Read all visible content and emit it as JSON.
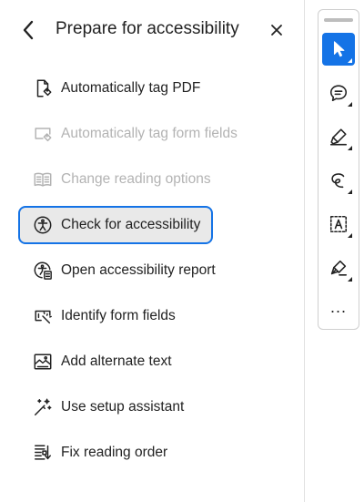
{
  "panel": {
    "title": "Prepare for accessibility",
    "back_icon": "chevron-left-icon",
    "close_icon": "close-icon"
  },
  "tools": [
    {
      "label": "Automatically tag PDF",
      "icon": "auto-tag-pdf-icon",
      "state": "enabled"
    },
    {
      "label": "Automatically tag form fields",
      "icon": "auto-tag-form-icon",
      "state": "disabled"
    },
    {
      "label": "Change reading options",
      "icon": "reading-options-icon",
      "state": "disabled"
    },
    {
      "label": "Check for accessibility",
      "icon": "accessibility-check-icon",
      "state": "selected"
    },
    {
      "label": "Open accessibility report",
      "icon": "accessibility-report-icon",
      "state": "enabled"
    },
    {
      "label": "Identify form fields",
      "icon": "identify-form-fields-icon",
      "state": "enabled"
    },
    {
      "label": "Add alternate text",
      "icon": "alternate-text-icon",
      "state": "enabled"
    },
    {
      "label": "Use setup assistant",
      "icon": "setup-assistant-icon",
      "state": "enabled"
    },
    {
      "label": "Fix reading order",
      "icon": "reading-order-icon",
      "state": "enabled"
    }
  ],
  "toolbar": {
    "more_label": "...",
    "buttons": [
      {
        "icon": "select-cursor-icon",
        "active": true
      },
      {
        "icon": "comment-icon",
        "active": false
      },
      {
        "icon": "highlighter-icon",
        "active": false
      },
      {
        "icon": "freehand-draw-icon",
        "active": false
      },
      {
        "icon": "text-select-icon",
        "active": false
      },
      {
        "icon": "sign-pen-icon",
        "active": false
      }
    ]
  },
  "colors": {
    "accent": "#1473e6",
    "selected_bg": "#e9e9e9",
    "disabled_text": "#b3b3b3",
    "text": "#222222"
  }
}
